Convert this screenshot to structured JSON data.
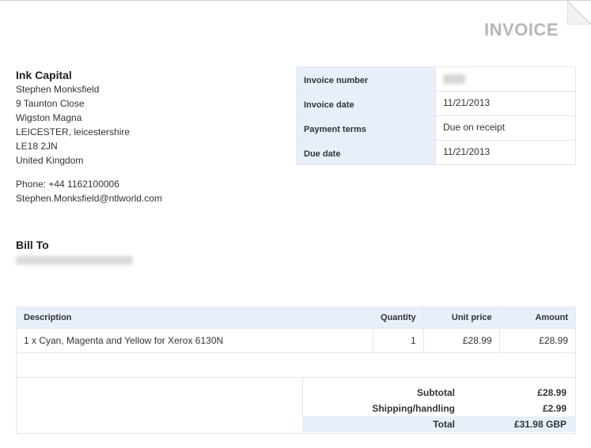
{
  "invoice": {
    "title": "INVOICE",
    "seller": {
      "name": "Ink Capital",
      "contact_name": "Stephen Monksfield",
      "address_lines": [
        "9 Taunton Close",
        "Wigston Magna",
        "LEICESTER, leicestershire",
        "LE18 2JN",
        "United Kingdom"
      ],
      "phone": "Phone: +44 1162100006",
      "email": "Stephen.Monksfield@ntlworld.com"
    },
    "meta": [
      {
        "label": "Invoice number",
        "value": ""
      },
      {
        "label": "Invoice date",
        "value": "11/21/2013"
      },
      {
        "label": "Payment terms",
        "value": "Due on receipt"
      },
      {
        "label": "Due date",
        "value": "11/21/2013"
      }
    ],
    "bill_to": {
      "heading": "Bill To"
    },
    "items_table": {
      "headers": {
        "description": "Description",
        "quantity": "Quantity",
        "unit_price": "Unit price",
        "amount": "Amount"
      },
      "rows": [
        {
          "description": "1 x Cyan, Magenta and Yellow for Xerox 6130N",
          "quantity": "1",
          "unit_price": "£28.99",
          "amount": "£28.99"
        }
      ]
    },
    "totals": {
      "subtotal_label": "Subtotal",
      "subtotal": "£28.99",
      "shipping_label": "Shipping/handling",
      "shipping": "£2.99",
      "total_label": "Total",
      "total": "£31.98 GBP"
    },
    "colors": {
      "header_bg": "#e7eff8",
      "border": "#e4e8ec",
      "title": "#b7b7b7"
    }
  }
}
